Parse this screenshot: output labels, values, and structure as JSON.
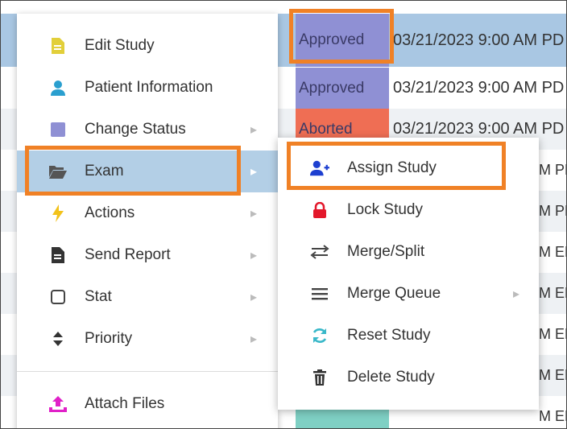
{
  "rows": [
    {
      "status": "Approved",
      "date": "03/21/2023 9:00 AM PD",
      "status_color": "#8f90d4",
      "row_color": "#a9c7e3"
    },
    {
      "status": "Approved",
      "date": "03/21/2023 9:00 AM PD",
      "status_color": "#8f90d4",
      "row_color": "#ffffff"
    },
    {
      "status": "Aborted",
      "date": "03/21/2023 9:00 AM PD",
      "status_color": "#ef6e54",
      "row_color": "#eef1f4"
    },
    {
      "status": "",
      "date": "M PD",
      "status_color": "#ffffff",
      "row_color": "#ffffff"
    },
    {
      "status": "",
      "date": "M PD",
      "status_color": "#ffffff",
      "row_color": "#eef1f4"
    },
    {
      "status": "",
      "date": "M ED",
      "status_color": "#ffffff",
      "row_color": "#ffffff"
    },
    {
      "status": "",
      "date": "M ED",
      "status_color": "#ffffff",
      "row_color": "#eef1f4"
    },
    {
      "status": "",
      "date": "M ED",
      "status_color": "#ffffff",
      "row_color": "#ffffff"
    },
    {
      "status": "",
      "date": "M ED",
      "status_color": "#ffffff",
      "row_color": "#eef1f4"
    },
    {
      "status": "",
      "date": "M ED",
      "status_color": "#7fd0c4",
      "row_color": "#ffffff"
    }
  ],
  "menu": {
    "items": [
      {
        "label": "Edit Study",
        "icon": "file-edit-icon",
        "has_submenu": false
      },
      {
        "label": "Patient Information",
        "icon": "person-icon",
        "has_submenu": false
      },
      {
        "label": "Change Status",
        "icon": "status-square-icon",
        "has_submenu": true
      },
      {
        "label": "Exam",
        "icon": "folder-open-icon",
        "has_submenu": true
      },
      {
        "label": "Actions",
        "icon": "bolt-icon",
        "has_submenu": true
      },
      {
        "label": "Send Report",
        "icon": "document-icon",
        "has_submenu": true
      },
      {
        "label": "Stat",
        "icon": "checkbox-icon",
        "has_submenu": true
      },
      {
        "label": "Priority",
        "icon": "sort-icon",
        "has_submenu": true
      },
      {
        "label": "Attach Files",
        "icon": "upload-icon",
        "has_submenu": false
      }
    ]
  },
  "submenu": {
    "items": [
      {
        "label": "Assign Study",
        "icon": "user-plus-icon",
        "has_submenu": false
      },
      {
        "label": "Lock Study",
        "icon": "lock-icon",
        "has_submenu": false
      },
      {
        "label": "Merge/Split",
        "icon": "swap-arrows-icon",
        "has_submenu": false
      },
      {
        "label": "Merge Queue",
        "icon": "list-icon",
        "has_submenu": true
      },
      {
        "label": "Reset Study",
        "icon": "refresh-icon",
        "has_submenu": false
      },
      {
        "label": "Delete Study",
        "icon": "trash-icon",
        "has_submenu": false
      }
    ]
  },
  "colors": {
    "highlight": "#f08126",
    "active_item": "#b3cfe6",
    "edit_icon": "#e2cf3a",
    "person_icon": "#2a9fcf",
    "status_icon": "#8f90d4",
    "bolt_icon": "#f2c21b",
    "upload_icon": "#e020c8",
    "assign_icon": "#1d3fd0",
    "lock_icon": "#e3182b",
    "refresh_icon": "#39b8c9"
  }
}
